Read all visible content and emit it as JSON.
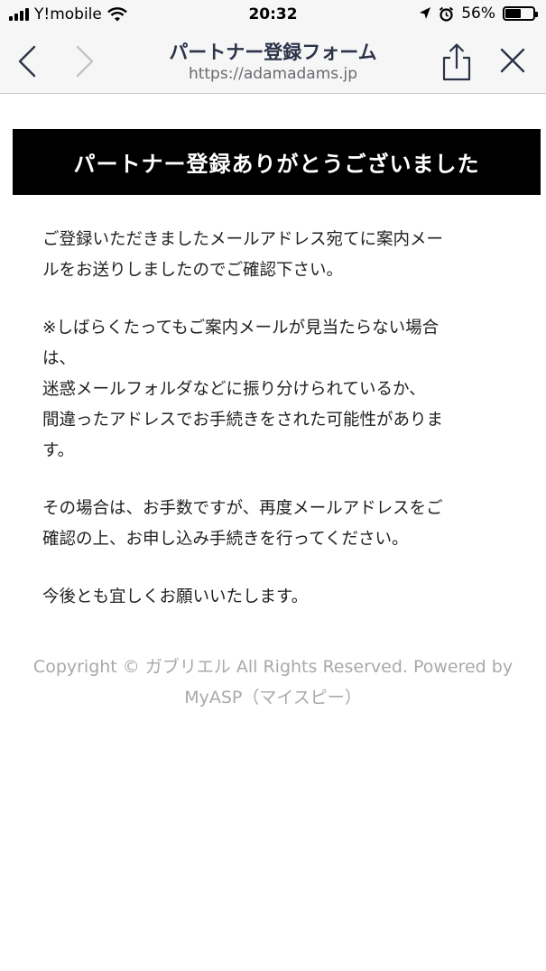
{
  "status_bar": {
    "carrier": "Y!mobile",
    "time": "20:32",
    "battery": "56%",
    "battery_level": 0.56,
    "icons": [
      "signal-icon",
      "wifi-icon",
      "location-arrow-icon",
      "alarm-icon",
      "battery-icon"
    ]
  },
  "browser": {
    "title": "パートナー登録フォーム",
    "url": "https://adamadams.jp",
    "buttons": [
      "back-icon",
      "forward-icon",
      "share-icon",
      "close-icon"
    ]
  },
  "banner": {
    "text": "パートナー登録ありがとうございました"
  },
  "message": {
    "p1": {
      "l1": "ご登録いただきましたメールアドレス宛てに案内メー",
      "l2": "ルをお送りしましたのでご確認下さい。"
    },
    "p2": {
      "l1": "※しばらくたってもご案内メールが見当たらない場合",
      "l2": "は、",
      "l3": "迷惑メールフォルダなどに振り分けられているか、",
      "l4": "間違ったアドレスでお手続きをされた可能性がありま",
      "l5": "す。"
    },
    "p3": {
      "l1": "その場合は、お手数ですが、再度メールアドレスをご",
      "l2": "確認の上、お申し込み手続きを行ってください。"
    },
    "p4": {
      "l1": "今後とも宜しくお願いいたします。"
    }
  },
  "footer": {
    "l1": "Copyright © ガブリエル All Rights Reserved. Powered by",
    "l2": "MyASP（マイスピー）"
  },
  "colors": {
    "banner_bg": "#000000",
    "banner_text": "#ffffff",
    "title": "#2c3348",
    "footer_text": "#a9a9a9"
  }
}
